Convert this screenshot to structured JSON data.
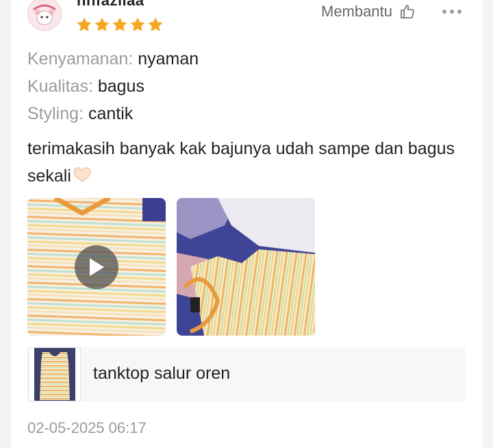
{
  "review": {
    "username": "nnfaziiaa",
    "rating": 5,
    "helpful_label": "Membantu",
    "attributes": [
      {
        "key": "Kenyamanan:",
        "value": "nyaman"
      },
      {
        "key": "Kualitas:",
        "value": "bagus"
      },
      {
        "key": "Styling:",
        "value": "cantik"
      }
    ],
    "comment": "terimakasih banyak kak bajunya udah sampe dan bagus sekali",
    "product_name": "tanktop salur oren",
    "date": "02-05-2025 06:17"
  },
  "icons": {
    "star": "star-icon",
    "thumbs_up": "thumbs-up-icon",
    "more": "more-dots-icon",
    "play": "play-icon",
    "heart": "heart-hands-emoji"
  },
  "colors": {
    "star": "#f5a623",
    "muted_text": "#9b9b9b",
    "text": "#222222",
    "product_bg": "#f7f7f7"
  }
}
